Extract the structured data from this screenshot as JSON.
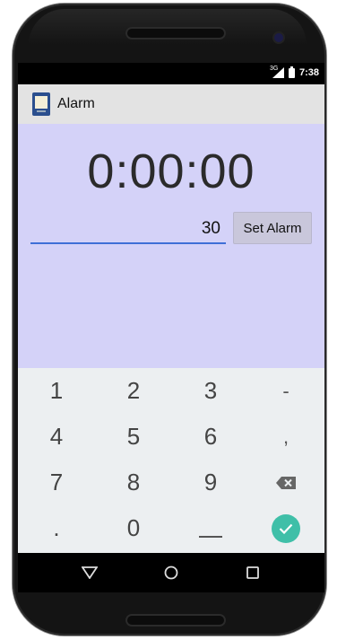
{
  "status_bar": {
    "network": "3G",
    "time": "7:38"
  },
  "action_bar": {
    "title": "Alarm",
    "icon": "alarm-app-icon"
  },
  "main": {
    "timer_display": "0:00:00",
    "minutes_input": {
      "value": "30"
    },
    "set_alarm_label": "Set Alarm"
  },
  "keyboard": {
    "rows": [
      [
        "1",
        "2",
        "3",
        "-"
      ],
      [
        "4",
        "5",
        "6",
        ","
      ],
      [
        "7",
        "8",
        "9",
        "backspace-icon"
      ],
      [
        ".",
        "0",
        "space-icon",
        "done-check-icon"
      ]
    ],
    "done_color": "#3fbfa8"
  },
  "nav_bar": {
    "buttons": [
      "back-icon",
      "home-icon",
      "recents-icon"
    ]
  },
  "colors": {
    "content_background": "#d4d2f8",
    "action_bar": "#e3e3e3",
    "input_underline": "#3f6fd7"
  }
}
